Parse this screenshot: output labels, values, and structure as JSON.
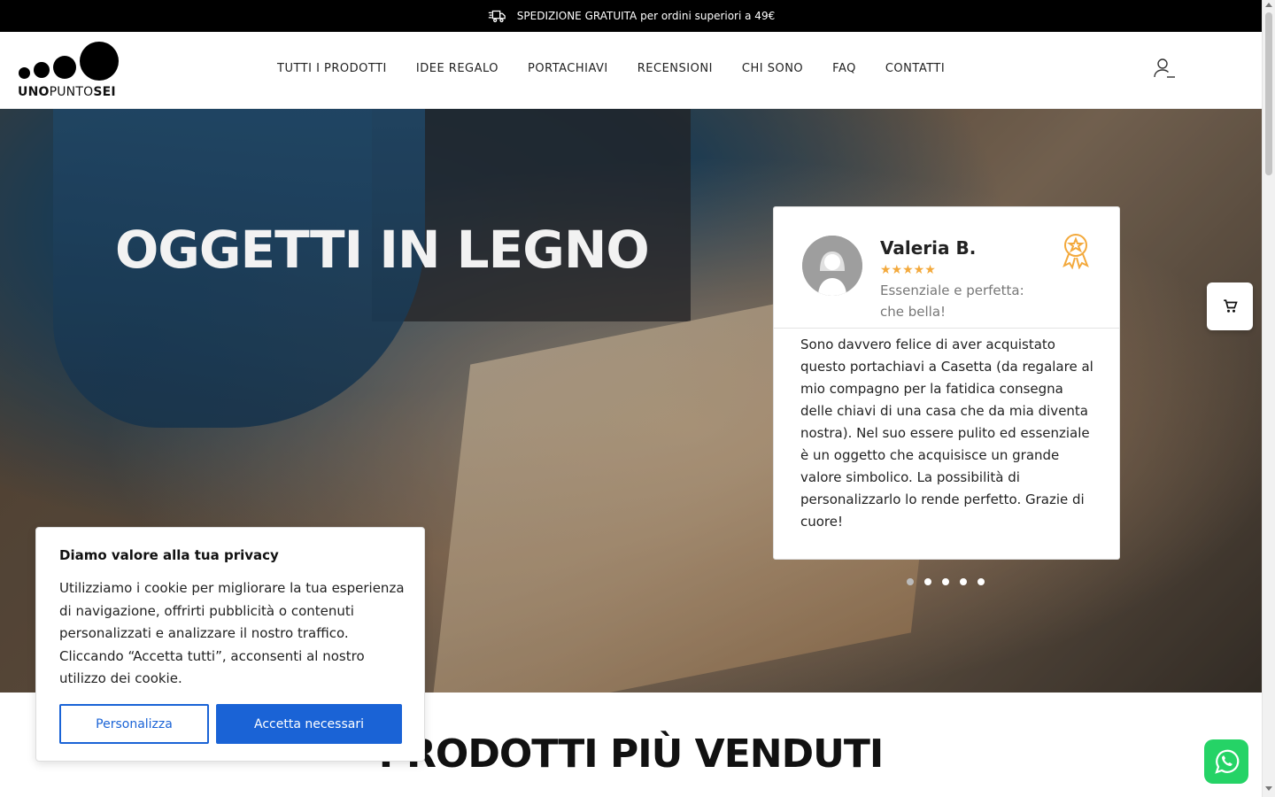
{
  "topbar": {
    "icon": "shipping-icon",
    "text": "SPEDIZIONE GRATUITA per ordini superiori a 49€"
  },
  "header": {
    "logo": {
      "bold_part": "UNO",
      "regular_part": "PUNTO",
      "bold_end": "SEI"
    },
    "nav": [
      {
        "label": "TUTTI I PRODOTTI"
      },
      {
        "label": "IDEE REGALO"
      },
      {
        "label": "PORTACHIAVI"
      },
      {
        "label": "RECENSIONI"
      },
      {
        "label": "CHI SONO"
      },
      {
        "label": "FAQ"
      },
      {
        "label": "CONTATTI"
      }
    ],
    "account_icon": "user-icon"
  },
  "hero": {
    "title": "OGGETTI IN LEGNO",
    "review": {
      "name": "Valeria B.",
      "rating": 5,
      "stars": "★★★★★",
      "title": "Essenziale e perfetta: che bella!",
      "body": "Sono davvero felice di aver acquistato questo portachiavi a Casetta (da regalare al mio compagno per la fatidica consegna delle chiavi di una casa che da mia diventa nostra). Nel suo essere pulito ed essenziale è un oggetto che acquisisce un grande valore simbolico. La possibilità di personalizzarlo lo rende perfetto. Grazie di cuore!",
      "badge_icon": "award-ribbon-icon"
    },
    "slides_count": 5,
    "active_slide": 1
  },
  "section": {
    "title": "PRODOTTI PIÙ VENDUTI"
  },
  "cookie": {
    "title": "Diamo valore alla tua privacy",
    "text": "Utilizziamo i cookie per migliorare la tua esperienza di navigazione, offrirti pubblicità o contenuti personalizzati e analizzare il nostro traffico. Cliccando “Accetta tutti”, acconsenti al nostro utilizzo dei cookie.",
    "customize_label": "Personalizza",
    "accept_label": "Accetta necessari"
  },
  "floating": {
    "cart_icon": "cart-icon",
    "whatsapp_icon": "whatsapp-icon"
  },
  "colors": {
    "accent": "#1a63d6",
    "star": "#f3a93c",
    "whatsapp": "#25d366"
  }
}
